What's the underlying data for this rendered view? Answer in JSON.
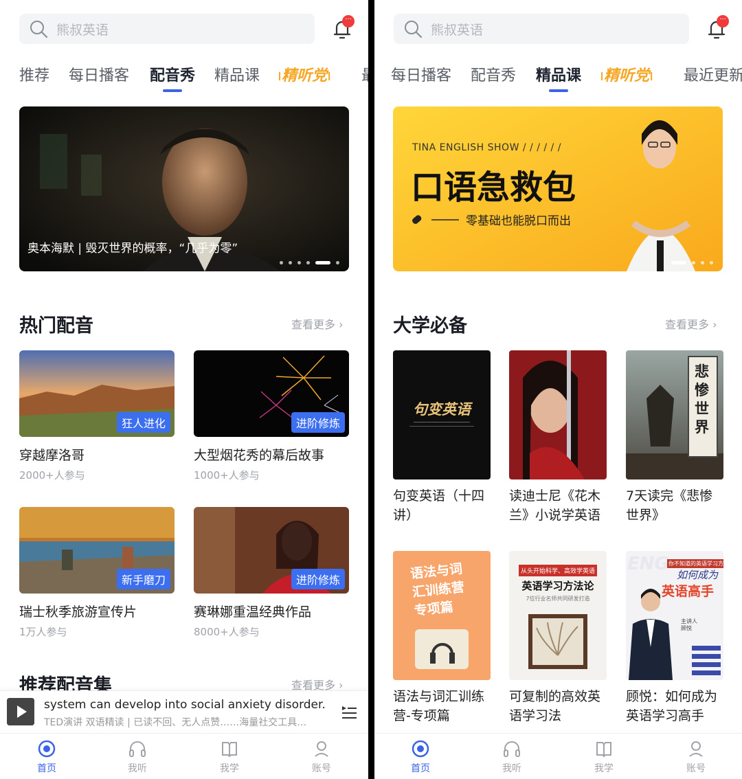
{
  "left": {
    "search": {
      "placeholder": "熊叔英语"
    },
    "tabs": [
      {
        "label": "推荐"
      },
      {
        "label": "每日播客"
      },
      {
        "label": "配音秀"
      },
      {
        "label": "精品课"
      },
      {
        "label": "精听党"
      },
      {
        "label": "最"
      }
    ],
    "banner": {
      "caption": "奥本海默 | 毁灭世界的概率，“几乎为零”"
    },
    "section1": {
      "title": "热门配音",
      "more": "查看更多 ›"
    },
    "cards": [
      {
        "title": "穿越摩洛哥",
        "sub": "2000+人参与",
        "tag": "狂人进化"
      },
      {
        "title": "大型烟花秀的幕后故事",
        "sub": "1000+人参与",
        "tag": "进阶修炼"
      },
      {
        "title": "瑞士秋季旅游宣传片",
        "sub": "1万人参与",
        "tag": "新手磨刀"
      },
      {
        "title": "赛琳娜重温经典作品",
        "sub": "8000+人参与",
        "tag": "进阶修炼"
      }
    ],
    "section2": {
      "title": "推荐配音集",
      "more": "查看更多 ›"
    },
    "player": {
      "line1": "system can develop into social anxiety disorder.",
      "line2": "TED演讲 双语精读 | 已读不回、无人点赞……海量社交工具…"
    }
  },
  "right": {
    "search": {
      "placeholder": "熊叔英语"
    },
    "tabs": [
      {
        "label": "每日播客"
      },
      {
        "label": "配音秀"
      },
      {
        "label": "精品课"
      },
      {
        "label": "精听党"
      },
      {
        "label": "最近更新"
      }
    ],
    "banner": {
      "kicker": "TINA ENGLISH SHOW / / / / / /",
      "headline": "口语急救包",
      "tagline": "零基础也能脱口而出"
    },
    "section1": {
      "title": "大学必备",
      "more": "查看更多 ›"
    },
    "books": [
      {
        "title": "句变英语（十四讲）",
        "cover_text": "句变英语"
      },
      {
        "title": "读迪士尼《花木兰》小说学英语"
      },
      {
        "title": "7天读完《悲惨世界》",
        "cover_text": "悲惨世界"
      },
      {
        "title": "语法与词汇训练营-专项篇",
        "cover_text": "语法与词汇训练营专项篇"
      },
      {
        "title": "可复制的高效英语学习法",
        "cover_text": "英语学习方法论",
        "cover_kicker": "从头开始科学、高效学英语",
        "cover_sub": "7位行业名师共同研发打造"
      },
      {
        "title": "顾悦：如何成为英语学习高手",
        "cover_text": "如何成为",
        "cover_text2": "英语高手",
        "cover_kicker": "你不知道的英语学习方法",
        "cover_name": "主讲人 顾悦"
      }
    ]
  },
  "nav": [
    {
      "label": "首页"
    },
    {
      "label": "我听"
    },
    {
      "label": "我学"
    },
    {
      "label": "账号"
    }
  ],
  "colors": {
    "accent": "#3b63e6",
    "tag": "#3c6ef0",
    "special_tab": "#f5a623",
    "badge": "#ef3b3b"
  }
}
